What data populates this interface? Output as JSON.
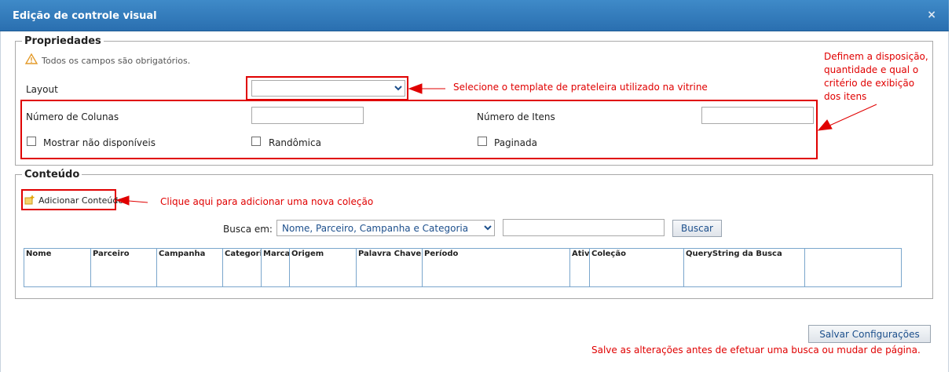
{
  "window": {
    "title": "Edição de controle visual",
    "close_glyph": "×"
  },
  "properties": {
    "legend": "Propriedades",
    "required_note": "Todos os campos são obrigatórios.",
    "layout_label": "Layout",
    "layout_value": "",
    "columns_label": "Número de Colunas",
    "columns_value": "",
    "items_label": "Número de Itens",
    "items_value": "",
    "show_unavailable_label": "Mostrar não disponíveis",
    "show_unavailable_checked": false,
    "random_label": "Randômica",
    "random_checked": false,
    "paginated_label": "Paginada",
    "paginated_checked": false
  },
  "content": {
    "legend": "Conteúdo",
    "add_label": "Adicionar Conteúdo",
    "search_label": "Busca em:",
    "search_scope_value": "Nome, Parceiro, Campanha e Categoria",
    "search_query": "",
    "search_button": "Buscar",
    "table_headers": [
      "Nome",
      "Parceiro",
      "Campanha",
      "Categoria",
      "Marca",
      "Origem",
      "Palavra Chave",
      "Período",
      "Ativo",
      "Coleção",
      "QueryString da Busca",
      ""
    ]
  },
  "annotations": {
    "layout_hint": "Selecione o template de prateleira utilizado na vitrine",
    "grid_hint": "Definem a disposição, quantidade e qual o critério de exibição dos itens",
    "add_hint": "Clique aqui para adicionar uma nova coleção",
    "save_hint": "Salve as alterações antes de efetuar uma busca ou mudar de página."
  },
  "footer": {
    "save_button": "Salvar Configurações"
  },
  "colors": {
    "titlebar": "#2a6fb0",
    "annotation": "#e00000",
    "grid_border": "#7aa6cc",
    "link_text": "#1c4f8c"
  },
  "icons": {
    "warning": "warning-icon",
    "close": "close-icon",
    "add": "add-content-icon"
  }
}
